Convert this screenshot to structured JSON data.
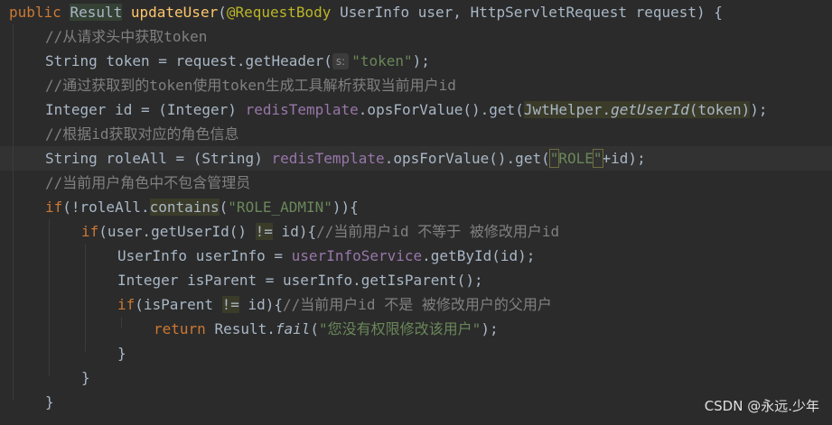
{
  "editor": {
    "lines": [
      [
        {
          "t": "public ",
          "c": "kw"
        },
        {
          "t": "Result",
          "c": "cls hl-usage"
        },
        {
          "t": " ",
          "c": ""
        },
        {
          "t": "updateUser",
          "c": "fn"
        },
        {
          "t": "(",
          "c": ""
        },
        {
          "t": "@RequestBody",
          "c": "ann"
        },
        {
          "t": " UserInfo user, HttpServletRequest request) {",
          "c": ""
        }
      ],
      [
        {
          "t": "//从请求头中获取token",
          "c": "cmt"
        }
      ],
      [
        {
          "t": "String token = request.getHeader(",
          "c": ""
        },
        {
          "t": "s:",
          "c": "hint"
        },
        {
          "t": "\"token\"",
          "c": "str"
        },
        {
          "t": ");",
          "c": ""
        }
      ],
      [
        {
          "t": "//通过获取到的token使用token生成工具解析获取当前用户id",
          "c": "cmt"
        }
      ],
      [
        {
          "t": "Integer id = (Integer) ",
          "c": ""
        },
        {
          "t": "redisTemplate",
          "c": "fld"
        },
        {
          "t": ".opsForValue().get(",
          "c": ""
        },
        {
          "t": "JwtHelper.",
          "c": "hl-warn"
        },
        {
          "t": "getUserId",
          "c": "it hl-warn"
        },
        {
          "t": "(token)",
          "c": "hl-warn"
        },
        {
          "t": ");",
          "c": ""
        }
      ],
      [
        {
          "t": "//根据id获取对应的角色信息",
          "c": "cmt"
        }
      ],
      [
        {
          "t": "String roleAll = (String) ",
          "c": ""
        },
        {
          "t": "redisTemplate",
          "c": "fld"
        },
        {
          "t": ".opsForValue().get(",
          "c": ""
        },
        {
          "t": "\"",
          "c": "str bracket-match"
        },
        {
          "t": "ROLE",
          "c": "str"
        },
        {
          "t": "\"",
          "c": "str bracket-match"
        },
        {
          "t": "+id);",
          "c": ""
        }
      ],
      [
        {
          "t": "//当前用户角色中不包含管理员",
          "c": "cmt"
        }
      ],
      [
        {
          "t": "if",
          "c": "kw"
        },
        {
          "t": "(!roleAll.",
          "c": ""
        },
        {
          "t": "contains",
          "c": "hl-warn"
        },
        {
          "t": "(",
          "c": ""
        },
        {
          "t": "\"ROLE_ADMIN\"",
          "c": "str"
        },
        {
          "t": ")){",
          "c": ""
        }
      ],
      [
        {
          "t": "if",
          "c": "kw"
        },
        {
          "t": "(user.getUserId() ",
          "c": ""
        },
        {
          "t": "!=",
          "c": "hl-warn"
        },
        {
          "t": " id){",
          "c": ""
        },
        {
          "t": "//当前用户id 不等于 被修改用户id",
          "c": "cmt"
        }
      ],
      [
        {
          "t": "UserInfo userInfo = ",
          "c": ""
        },
        {
          "t": "userInfoService",
          "c": "fld"
        },
        {
          "t": ".getById(id);",
          "c": ""
        }
      ],
      [
        {
          "t": "Integer isParent = userInfo.getIsParent();",
          "c": ""
        }
      ],
      [
        {
          "t": "if",
          "c": "kw"
        },
        {
          "t": "(isParent ",
          "c": ""
        },
        {
          "t": "!=",
          "c": "hl-warn"
        },
        {
          "t": " id){",
          "c": ""
        },
        {
          "t": "//当前用户id 不是 被修改用户的父用户",
          "c": "cmt"
        }
      ],
      [
        {
          "t": "return ",
          "c": "kw"
        },
        {
          "t": "Result.",
          "c": ""
        },
        {
          "t": "fail",
          "c": "it"
        },
        {
          "t": "(",
          "c": ""
        },
        {
          "t": "\"您没有权限修改该用户\"",
          "c": "str"
        },
        {
          "t": ");",
          "c": ""
        }
      ],
      [
        {
          "t": "}",
          "c": ""
        }
      ],
      [
        {
          "t": "}",
          "c": ""
        }
      ],
      [
        {
          "t": "}",
          "c": ""
        }
      ]
    ]
  },
  "watermark": "CSDN @永远.少年"
}
